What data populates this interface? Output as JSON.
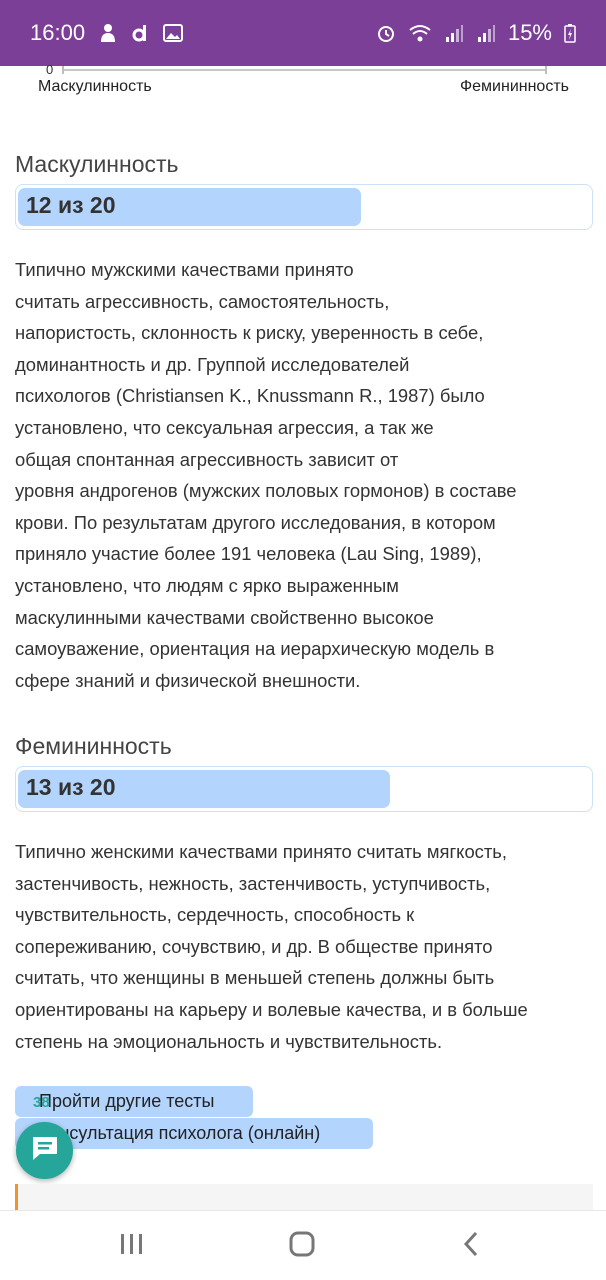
{
  "status_bar": {
    "time": "16:00",
    "battery": "15%",
    "icons": [
      "person-notification-icon",
      "d-app-icon",
      "gallery-icon",
      "alarm-icon",
      "wifi-icon",
      "signal-icon",
      "signal-icon",
      "battery-charging-icon"
    ],
    "bg_color": "#7b3f98"
  },
  "scale": {
    "zero_label": "0",
    "left_label": "Маскулинность",
    "right_label": "Фемининность"
  },
  "masculinity": {
    "title": "Маскулинность",
    "score_text": "12 из 20",
    "score": 12,
    "max": 20,
    "description": [
      "Типично мужскими качествами принято",
      "считать агрессивность,  самостоятельность,",
      "напористость,  склонность к риску, уверенность в себе,",
      "доминантность и др. Группой исследователей",
      "психологов (Christiansen K., Knussmann R., 1987) было",
      "установлено, что сексуальная агрессия, а так же",
      "общая спонтанная агрессивность зависит от",
      "уровня андрогенов (мужских половых гормонов) в составе",
      "крови. По результатам другого исследования, в котором",
      "приняло участие более 191 человека (Lau Sing, 1989),",
      "установлено, что людям с ярко выраженным",
      "маскулинными качествами свойственно высокое",
      "самоуважение, ориентация на иерархическую модель в",
      "сфере знаний и физической внешности."
    ]
  },
  "femininity": {
    "title": "Фемининность",
    "score_text": "13 из 20",
    "score": 13,
    "max": 20,
    "description": [
      "Типично женскими качествами принято считать  мягкость,",
      "застенчивость, нежность, застенчивость, уступчивость,",
      "чувствительность, сердечность, способность к",
      "сопереживанию, сочувствию, и др. В обществе принято",
      "считать, что женщины в меньшей степень должны быть",
      "ориентированы на карьеру и волевые качества, и в больше",
      "степень на эмоциональность и чувствительность."
    ]
  },
  "buttons": {
    "other_tests": "Пройти другие тесты",
    "consultation": "Консультация психолога (онлайн)"
  },
  "chat": {
    "badge": "38",
    "icon": "chat-bubble-icon",
    "color": "#26a69a"
  },
  "colors": {
    "bar_fill": "#b3d4fd",
    "accent_orange": "#f0932b"
  },
  "nav_bar": {
    "icons": [
      "recent-apps-icon",
      "home-icon",
      "back-icon"
    ]
  }
}
